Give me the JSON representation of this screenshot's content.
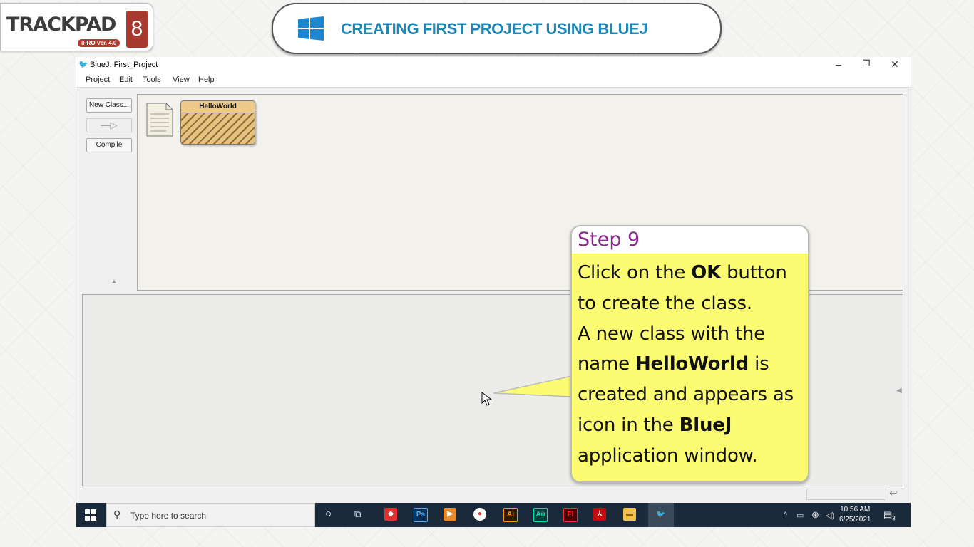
{
  "logo": {
    "text": "TRACKPAD",
    "number": "8",
    "version": "iPRO Ver. 4.0"
  },
  "banner": {
    "title": "CREATING FIRST PROJECT USING BLUEJ"
  },
  "window": {
    "title": "BlueJ:  First_Project",
    "controls": {
      "minimize": "–",
      "restore": "❐",
      "close": "✕"
    }
  },
  "menu": [
    "Project",
    "Edit",
    "Tools",
    "View",
    "Help"
  ],
  "side_buttons": {
    "new_class": "New Class...",
    "arrow": "—▷",
    "compile": "Compile"
  },
  "class_box": {
    "name": "HelloWorld"
  },
  "taskbar": {
    "search_placeholder": "Type here to search",
    "time": "10:56 AM",
    "date": "6/25/2021",
    "notification_count": "3",
    "apps": [
      {
        "label": "Ps",
        "color": "#0b2e57"
      },
      {
        "label": "Ai",
        "color": "#2d1a00"
      },
      {
        "label": "Au",
        "color": "#003f38"
      },
      {
        "label": "Fl",
        "color": "#4a0000"
      }
    ]
  },
  "callout": {
    "step": "Step 9",
    "line1_pre": "Click on the ",
    "line1_bold": "OK",
    "line1_post": " button",
    "line2": "to create the class.",
    "line3": "A new class with the",
    "line4_pre": "name ",
    "line4_bold": "HelloWorld",
    "line4_post": " is",
    "line5": "created and appears as",
    "line6_pre": "icon in the ",
    "line6_bold": "BlueJ",
    "line7": "application window."
  }
}
